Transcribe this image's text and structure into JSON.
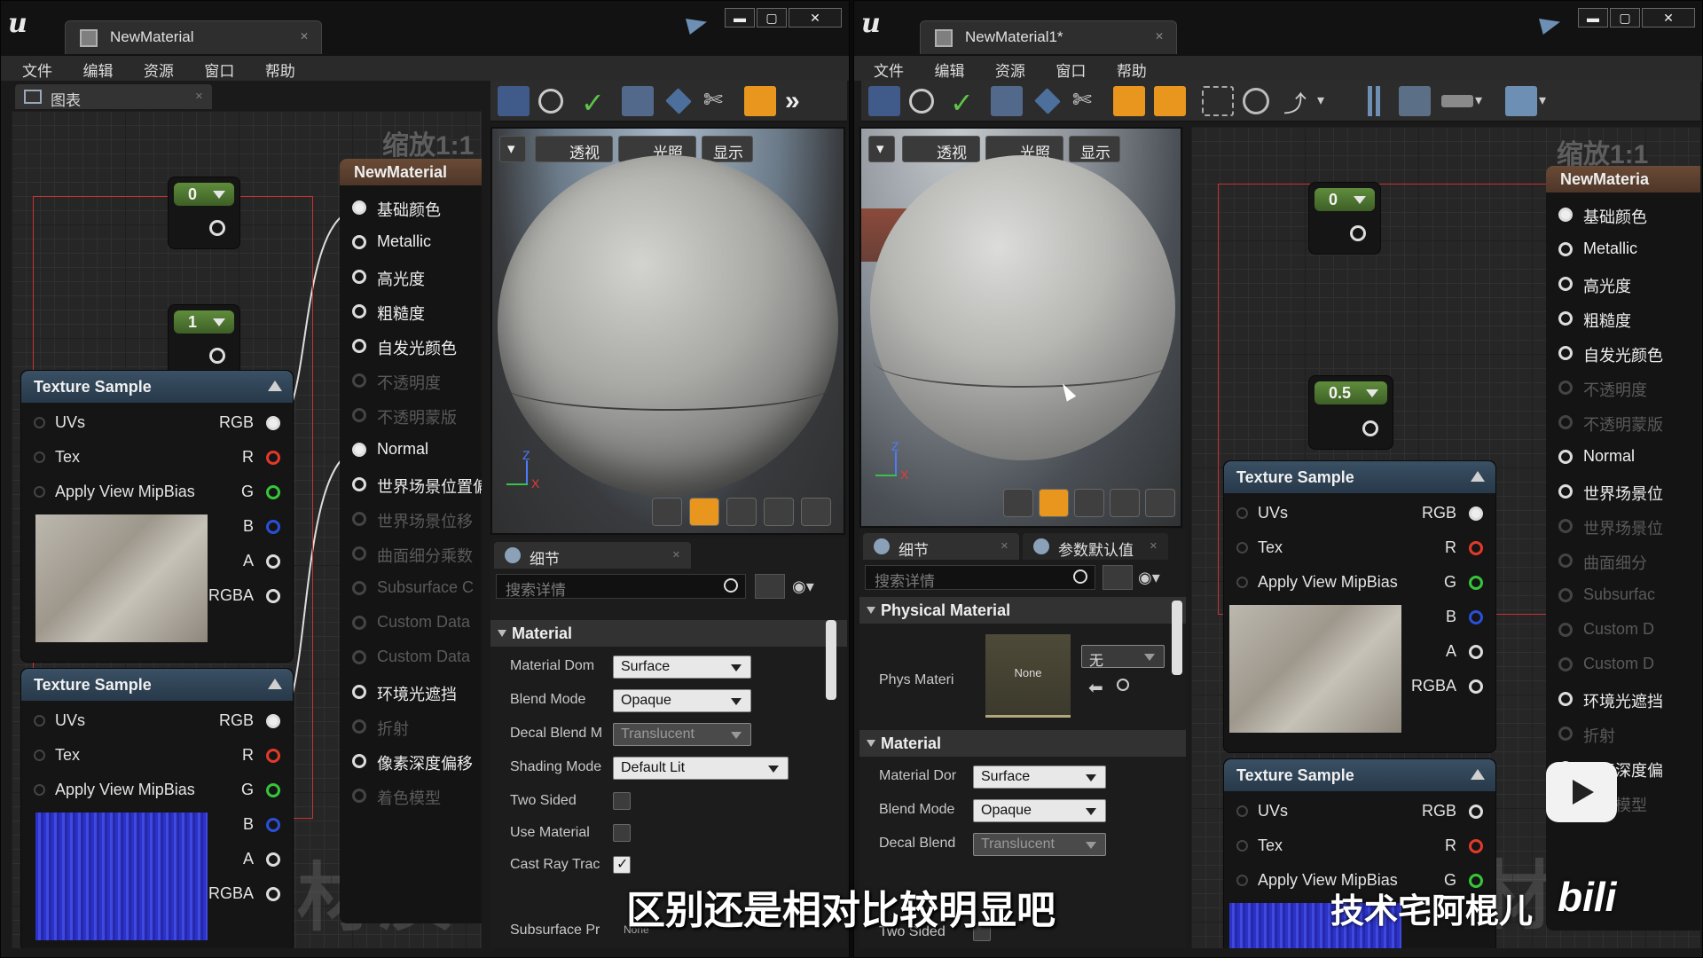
{
  "left": {
    "tab_title": "NewMaterial",
    "menu": [
      "文件",
      "编辑",
      "资源",
      "窗口",
      "帮助"
    ],
    "graph_tab": "图表",
    "zoom": "缩放1:1",
    "watermark": "材质",
    "const_a": "0",
    "const_b": "1",
    "result_title": "NewMaterial",
    "result_pins": [
      "基础颜色",
      "Metallic",
      "高光度",
      "粗糙度",
      "自发光颜色",
      "不透明度",
      "不透明蒙版",
      "Normal",
      "世界场景位置偏",
      "世界场景位移",
      "曲面细分乘数",
      "Subsurface C",
      "Custom Data",
      "Custom Data",
      "环境光遮挡",
      "折射",
      "像素深度偏移",
      "着色模型"
    ],
    "viewport_buttons": [
      "透视",
      "光照",
      "显示"
    ],
    "details_tab": "细节",
    "search_placeholder": "搜索详情",
    "category_material": "Material",
    "props": {
      "material_domain_label": "Material Dom",
      "material_domain_value": "Surface",
      "blend_mode_label": "Blend Mode",
      "blend_mode_value": "Opaque",
      "decal_blend_label": "Decal Blend M",
      "decal_blend_value": "Translucent",
      "shading_model_label": "Shading Mode",
      "shading_model_value": "Default Lit",
      "two_sided_label": "Two Sided",
      "use_material_label": "Use Material",
      "cast_ray_label": "Cast Ray Trac",
      "subsurface_label": "Subsurface Pr",
      "subsurface_value": "None"
    }
  },
  "right": {
    "tab_title": "NewMaterial1*",
    "menu": [
      "文件",
      "编辑",
      "资源",
      "窗口",
      "帮助"
    ],
    "zoom": "缩放1:1",
    "watermark": "材质",
    "const_a": "0",
    "const_b": "0.5",
    "result_title": "NewMateria",
    "result_pins": [
      "基础颜色",
      "Metallic",
      "高光度",
      "粗糙度",
      "自发光颜色",
      "不透明度",
      "不透明蒙版",
      "Normal",
      "世界场景位",
      "世界场景位",
      "曲面细分",
      "Subsurfac",
      "Custom D",
      "Custom D",
      "环境光遮挡",
      "折射",
      "像素深度偏",
      "着色模型"
    ],
    "viewport_buttons": [
      "透视",
      "光照",
      "显示"
    ],
    "details_tab": "细节",
    "params_tab": "参数默认值",
    "search_placeholder": "搜索详情",
    "category_physical": "Physical Material",
    "phys_label": "Phys Materi",
    "phys_thumb": "None",
    "phys_combo": "无",
    "category_material": "Material",
    "props": {
      "material_domain_label": "Material Dor",
      "material_domain_value": "Surface",
      "blend_mode_label": "Blend Mode",
      "blend_mode_value": "Opaque",
      "decal_blend_label": "Decal Blend",
      "decal_blend_value": "Translucent",
      "two_sided_label": "Two Sided"
    }
  },
  "texture_node": {
    "title": "Texture Sample",
    "in_pins": [
      "UVs",
      "Tex",
      "Apply View MipBias"
    ],
    "out_pins": [
      "RGB",
      "R",
      "G",
      "B",
      "A",
      "RGBA"
    ]
  },
  "overlay": {
    "subtitle": "区别还是相对比较明显吧",
    "brand": "技术宅阿棍儿"
  },
  "colors": {
    "pin_red": "#e23a2a",
    "pin_green": "#36c63a",
    "pin_blue": "#2a4fd8",
    "accent_orange": "#e8961e"
  }
}
